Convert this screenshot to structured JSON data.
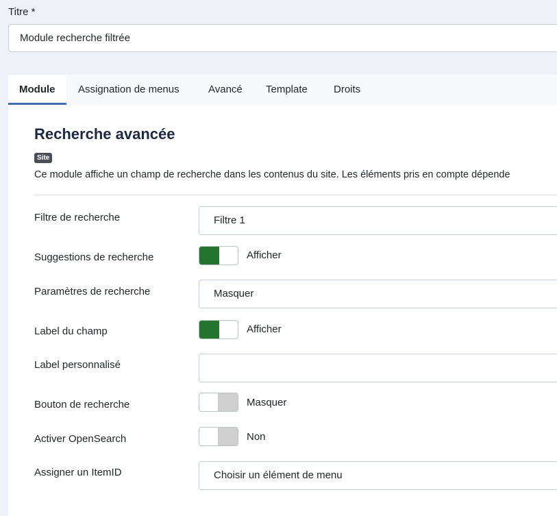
{
  "title_field": {
    "label": "Titre *",
    "value": "Module recherche filtrée"
  },
  "tabs": [
    {
      "label": "Module"
    },
    {
      "label": "Assignation de menus"
    },
    {
      "label": "Avancé"
    },
    {
      "label": "Template"
    },
    {
      "label": "Droits"
    }
  ],
  "module": {
    "heading": "Recherche avancée",
    "badge": "Site",
    "description": "Ce module affiche un champ de recherche dans les contenus du site. Les éléments pris en compte dépende"
  },
  "fields": {
    "search_filter": {
      "label": "Filtre de recherche",
      "value": "Filtre 1"
    },
    "search_suggestions": {
      "label": "Suggestions de recherche",
      "state": "Afficher"
    },
    "search_params": {
      "label": "Paramètres de recherche",
      "value": "Masquer"
    },
    "field_label": {
      "label": "Label du champ",
      "state": "Afficher"
    },
    "custom_label": {
      "label": "Label personnalisé",
      "value": ""
    },
    "search_button": {
      "label": "Bouton de recherche",
      "state": "Masquer"
    },
    "opensearch": {
      "label": "Activer OpenSearch",
      "state": "Non"
    },
    "itemid": {
      "label": "Assigner un ItemID",
      "value": "Choisir un élément de menu"
    }
  },
  "colors": {
    "toggle_on": "#24742f",
    "toggle_off": "#cfcfcf",
    "tab_active_border": "#3f6fb0"
  }
}
